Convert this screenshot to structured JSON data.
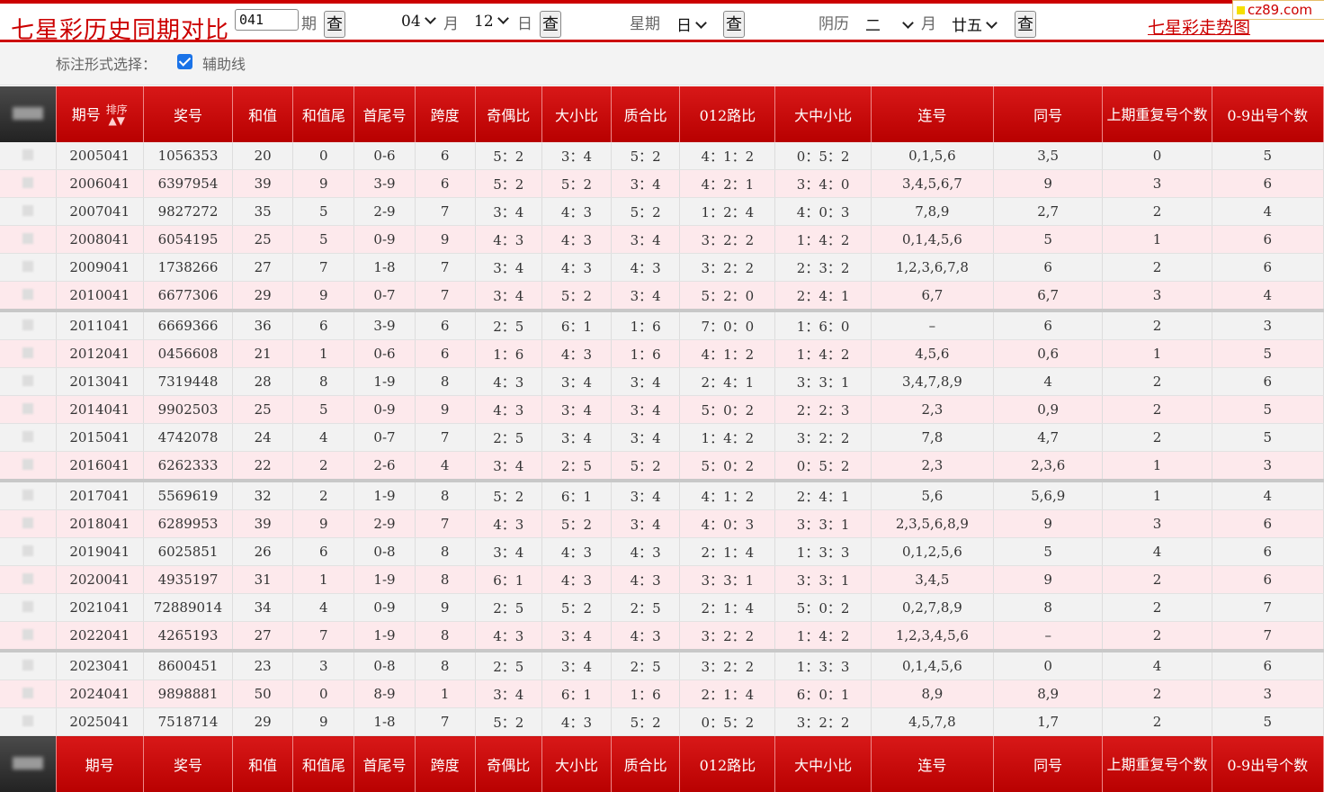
{
  "header": {
    "title": "七星彩历史同期对比",
    "issue_value": "041",
    "issue_unit": "期",
    "query_label": "查",
    "month_value": "04",
    "month_unit": "月",
    "day_value": "12",
    "day_unit": "日",
    "weekday_label": "星期",
    "weekday_value": "日",
    "lunar_label": "阴历",
    "lunar_month_value": "二",
    "lunar_month_unit": "月",
    "lunar_day_value": "廿五",
    "trend_link": "七星彩走势图",
    "watermark": "cz89.com"
  },
  "options": {
    "label": "标注形式选择：",
    "checkbox_label": "辅助线",
    "checked": true
  },
  "table": {
    "columns": [
      "期号",
      "奖号",
      "和值",
      "和值尾",
      "首尾号",
      "跨度",
      "奇偶比",
      "大小比",
      "质合比",
      "012路比",
      "大中小比",
      "连号",
      "同号",
      "上期重复号个数",
      "0-9出号个数"
    ],
    "sort_label": "排序",
    "rows": [
      [
        "2005041",
        "1056353",
        "20",
        "0",
        "0-6",
        "6",
        "5：2",
        "3：4",
        "5：2",
        "4：1：2",
        "0：5：2",
        "0,1,5,6",
        "3,5",
        "0",
        "5"
      ],
      [
        "2006041",
        "6397954",
        "39",
        "9",
        "3-9",
        "6",
        "5：2",
        "5：2",
        "3：4",
        "4：2：1",
        "3：4：0",
        "3,4,5,6,7",
        "9",
        "3",
        "6"
      ],
      [
        "2007041",
        "9827272",
        "35",
        "5",
        "2-9",
        "7",
        "3：4",
        "4：3",
        "5：2",
        "1：2：4",
        "4：0：3",
        "7,8,9",
        "2,7",
        "2",
        "4"
      ],
      [
        "2008041",
        "6054195",
        "25",
        "5",
        "0-9",
        "9",
        "4：3",
        "4：3",
        "3：4",
        "3：2：2",
        "1：4：2",
        "0,1,4,5,6",
        "5",
        "1",
        "6"
      ],
      [
        "2009041",
        "1738266",
        "27",
        "7",
        "1-8",
        "7",
        "3：4",
        "4：3",
        "4：3",
        "3：2：2",
        "2：3：2",
        "1,2,3,6,7,8",
        "6",
        "2",
        "6"
      ],
      [
        "2010041",
        "6677306",
        "29",
        "9",
        "0-7",
        "7",
        "3：4",
        "5：2",
        "3：4",
        "5：2：0",
        "2：4：1",
        "6,7",
        "6,7",
        "3",
        "4"
      ],
      [
        "2011041",
        "6669366",
        "36",
        "6",
        "3-9",
        "6",
        "2：5",
        "6：1",
        "1：6",
        "7：0：0",
        "1：6：0",
        "–",
        "6",
        "2",
        "3"
      ],
      [
        "2012041",
        "0456608",
        "21",
        "1",
        "0-6",
        "6",
        "1：6",
        "4：3",
        "1：6",
        "4：1：2",
        "1：4：2",
        "4,5,6",
        "0,6",
        "1",
        "5"
      ],
      [
        "2013041",
        "7319448",
        "28",
        "8",
        "1-9",
        "8",
        "4：3",
        "3：4",
        "3：4",
        "2：4：1",
        "3：3：1",
        "3,4,7,8,9",
        "4",
        "2",
        "6"
      ],
      [
        "2014041",
        "9902503",
        "25",
        "5",
        "0-9",
        "9",
        "4：3",
        "3：4",
        "3：4",
        "5：0：2",
        "2：2：3",
        "2,3",
        "0,9",
        "2",
        "5"
      ],
      [
        "2015041",
        "4742078",
        "24",
        "4",
        "0-7",
        "7",
        "2：5",
        "3：4",
        "3：4",
        "1：4：2",
        "3：2：2",
        "7,8",
        "4,7",
        "2",
        "5"
      ],
      [
        "2016041",
        "6262333",
        "22",
        "2",
        "2-6",
        "4",
        "3：4",
        "2：5",
        "5：2",
        "5：0：2",
        "0：5：2",
        "2,3",
        "2,3,6",
        "1",
        "3"
      ],
      [
        "2017041",
        "5569619",
        "32",
        "2",
        "1-9",
        "8",
        "5：2",
        "6：1",
        "3：4",
        "4：1：2",
        "2：4：1",
        "5,6",
        "5,6,9",
        "1",
        "4"
      ],
      [
        "2018041",
        "6289953",
        "39",
        "9",
        "2-9",
        "7",
        "4：3",
        "5：2",
        "3：4",
        "4：0：3",
        "3：3：1",
        "2,3,5,6,8,9",
        "9",
        "3",
        "6"
      ],
      [
        "2019041",
        "6025851",
        "26",
        "6",
        "0-8",
        "8",
        "3：4",
        "4：3",
        "4：3",
        "2：1：4",
        "1：3：3",
        "0,1,2,5,6",
        "5",
        "4",
        "6"
      ],
      [
        "2020041",
        "4935197",
        "31",
        "1",
        "1-9",
        "8",
        "6：1",
        "4：3",
        "4：3",
        "3：3：1",
        "3：3：1",
        "3,4,5",
        "9",
        "2",
        "6"
      ],
      [
        "2021041",
        "72889014",
        "34",
        "4",
        "0-9",
        "9",
        "2：5",
        "5：2",
        "2：5",
        "2：1：4",
        "5：0：2",
        "0,2,7,8,9",
        "8",
        "2",
        "7"
      ],
      [
        "2022041",
        "4265193",
        "27",
        "7",
        "1-9",
        "8",
        "4：3",
        "3：4",
        "4：3",
        "3：2：2",
        "1：4：2",
        "1,2,3,4,5,6",
        "–",
        "2",
        "7"
      ],
      [
        "2023041",
        "8600451",
        "23",
        "3",
        "0-8",
        "8",
        "2：5",
        "3：4",
        "2：5",
        "3：2：2",
        "1：3：3",
        "0,1,4,5,6",
        "0",
        "4",
        "6"
      ],
      [
        "2024041",
        "9898881",
        "50",
        "0",
        "8-9",
        "1",
        "3：4",
        "6：1",
        "1：6",
        "2：1：4",
        "6：0：1",
        "8,9",
        "8,9",
        "2",
        "3"
      ],
      [
        "2025041",
        "7518714",
        "29",
        "9",
        "1-8",
        "7",
        "5：2",
        "4：3",
        "5：2",
        "0：5：2",
        "3：2：2",
        "4,5,7,8",
        "1,7",
        "2",
        "5"
      ]
    ]
  },
  "colors": {
    "accent": "#cc0000",
    "header_bg": "#c80000",
    "row_a": "#f2f2f2",
    "row_b": "#fde9ec"
  }
}
